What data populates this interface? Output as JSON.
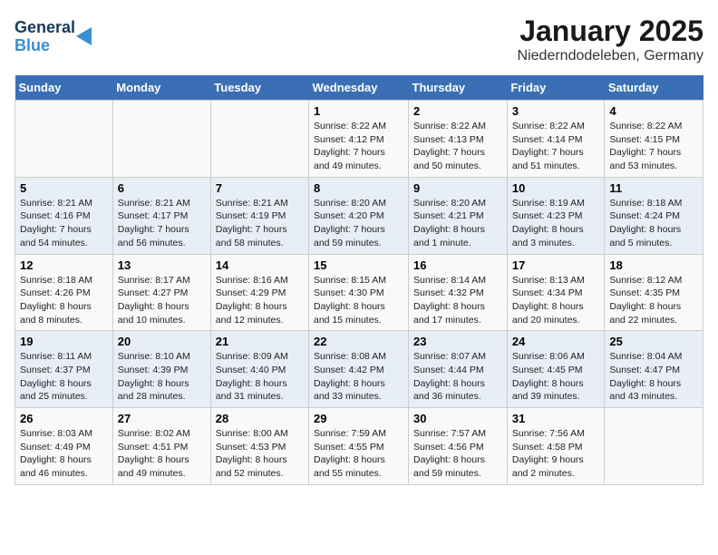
{
  "logo": {
    "general": "General",
    "blue": "Blue"
  },
  "title": "January 2025",
  "subtitle": "Niederndodeleben, Germany",
  "days_header": [
    "Sunday",
    "Monday",
    "Tuesday",
    "Wednesday",
    "Thursday",
    "Friday",
    "Saturday"
  ],
  "weeks": [
    [
      {
        "day": "",
        "info": ""
      },
      {
        "day": "",
        "info": ""
      },
      {
        "day": "",
        "info": ""
      },
      {
        "day": "1",
        "info": "Sunrise: 8:22 AM\nSunset: 4:12 PM\nDaylight: 7 hours\nand 49 minutes."
      },
      {
        "day": "2",
        "info": "Sunrise: 8:22 AM\nSunset: 4:13 PM\nDaylight: 7 hours\nand 50 minutes."
      },
      {
        "day": "3",
        "info": "Sunrise: 8:22 AM\nSunset: 4:14 PM\nDaylight: 7 hours\nand 51 minutes."
      },
      {
        "day": "4",
        "info": "Sunrise: 8:22 AM\nSunset: 4:15 PM\nDaylight: 7 hours\nand 53 minutes."
      }
    ],
    [
      {
        "day": "5",
        "info": "Sunrise: 8:21 AM\nSunset: 4:16 PM\nDaylight: 7 hours\nand 54 minutes."
      },
      {
        "day": "6",
        "info": "Sunrise: 8:21 AM\nSunset: 4:17 PM\nDaylight: 7 hours\nand 56 minutes."
      },
      {
        "day": "7",
        "info": "Sunrise: 8:21 AM\nSunset: 4:19 PM\nDaylight: 7 hours\nand 58 minutes."
      },
      {
        "day": "8",
        "info": "Sunrise: 8:20 AM\nSunset: 4:20 PM\nDaylight: 7 hours\nand 59 minutes."
      },
      {
        "day": "9",
        "info": "Sunrise: 8:20 AM\nSunset: 4:21 PM\nDaylight: 8 hours\nand 1 minute."
      },
      {
        "day": "10",
        "info": "Sunrise: 8:19 AM\nSunset: 4:23 PM\nDaylight: 8 hours\nand 3 minutes."
      },
      {
        "day": "11",
        "info": "Sunrise: 8:18 AM\nSunset: 4:24 PM\nDaylight: 8 hours\nand 5 minutes."
      }
    ],
    [
      {
        "day": "12",
        "info": "Sunrise: 8:18 AM\nSunset: 4:26 PM\nDaylight: 8 hours\nand 8 minutes."
      },
      {
        "day": "13",
        "info": "Sunrise: 8:17 AM\nSunset: 4:27 PM\nDaylight: 8 hours\nand 10 minutes."
      },
      {
        "day": "14",
        "info": "Sunrise: 8:16 AM\nSunset: 4:29 PM\nDaylight: 8 hours\nand 12 minutes."
      },
      {
        "day": "15",
        "info": "Sunrise: 8:15 AM\nSunset: 4:30 PM\nDaylight: 8 hours\nand 15 minutes."
      },
      {
        "day": "16",
        "info": "Sunrise: 8:14 AM\nSunset: 4:32 PM\nDaylight: 8 hours\nand 17 minutes."
      },
      {
        "day": "17",
        "info": "Sunrise: 8:13 AM\nSunset: 4:34 PM\nDaylight: 8 hours\nand 20 minutes."
      },
      {
        "day": "18",
        "info": "Sunrise: 8:12 AM\nSunset: 4:35 PM\nDaylight: 8 hours\nand 22 minutes."
      }
    ],
    [
      {
        "day": "19",
        "info": "Sunrise: 8:11 AM\nSunset: 4:37 PM\nDaylight: 8 hours\nand 25 minutes."
      },
      {
        "day": "20",
        "info": "Sunrise: 8:10 AM\nSunset: 4:39 PM\nDaylight: 8 hours\nand 28 minutes."
      },
      {
        "day": "21",
        "info": "Sunrise: 8:09 AM\nSunset: 4:40 PM\nDaylight: 8 hours\nand 31 minutes."
      },
      {
        "day": "22",
        "info": "Sunrise: 8:08 AM\nSunset: 4:42 PM\nDaylight: 8 hours\nand 33 minutes."
      },
      {
        "day": "23",
        "info": "Sunrise: 8:07 AM\nSunset: 4:44 PM\nDaylight: 8 hours\nand 36 minutes."
      },
      {
        "day": "24",
        "info": "Sunrise: 8:06 AM\nSunset: 4:45 PM\nDaylight: 8 hours\nand 39 minutes."
      },
      {
        "day": "25",
        "info": "Sunrise: 8:04 AM\nSunset: 4:47 PM\nDaylight: 8 hours\nand 43 minutes."
      }
    ],
    [
      {
        "day": "26",
        "info": "Sunrise: 8:03 AM\nSunset: 4:49 PM\nDaylight: 8 hours\nand 46 minutes."
      },
      {
        "day": "27",
        "info": "Sunrise: 8:02 AM\nSunset: 4:51 PM\nDaylight: 8 hours\nand 49 minutes."
      },
      {
        "day": "28",
        "info": "Sunrise: 8:00 AM\nSunset: 4:53 PM\nDaylight: 8 hours\nand 52 minutes."
      },
      {
        "day": "29",
        "info": "Sunrise: 7:59 AM\nSunset: 4:55 PM\nDaylight: 8 hours\nand 55 minutes."
      },
      {
        "day": "30",
        "info": "Sunrise: 7:57 AM\nSunset: 4:56 PM\nDaylight: 8 hours\nand 59 minutes."
      },
      {
        "day": "31",
        "info": "Sunrise: 7:56 AM\nSunset: 4:58 PM\nDaylight: 9 hours\nand 2 minutes."
      },
      {
        "day": "",
        "info": ""
      }
    ]
  ]
}
